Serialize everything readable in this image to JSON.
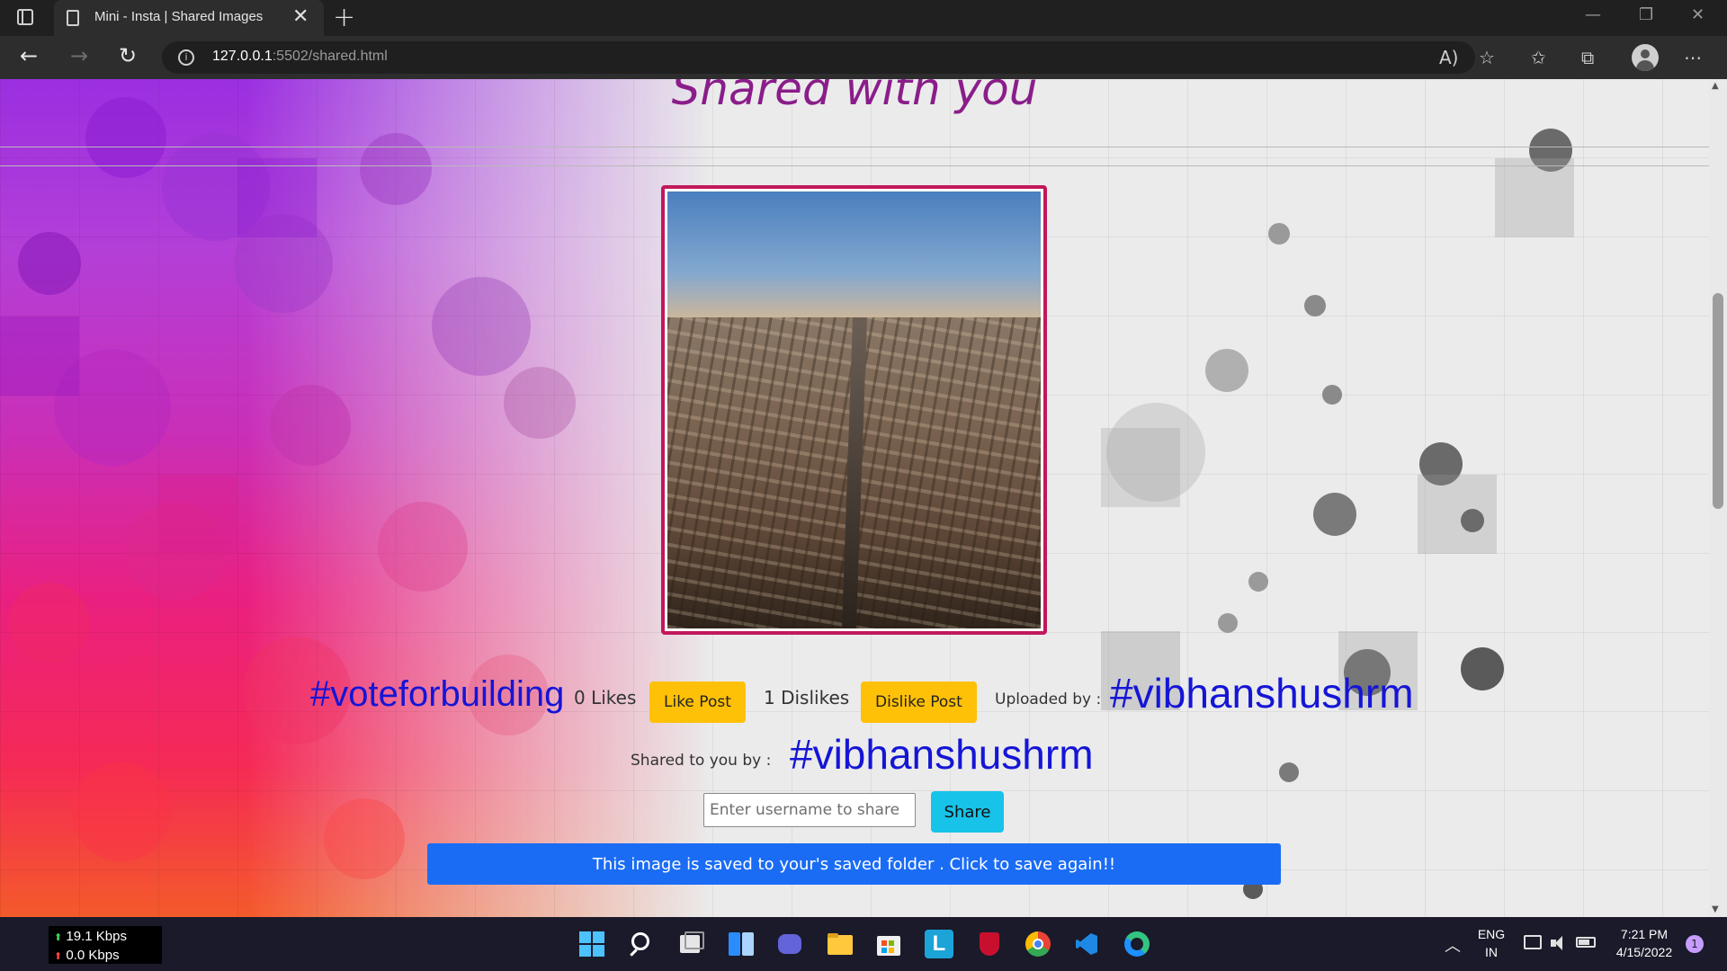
{
  "browser": {
    "tab_title": "Mini - Insta | Shared Images",
    "tab_close": "✕",
    "new_tab": "+",
    "url_host": "127.0.0.1",
    "url_rest": ":5502/shared.html",
    "win_minimize": "—",
    "win_restore": "❐",
    "win_close": "✕",
    "nav_back": "←",
    "nav_forward": "→",
    "nav_reload": "↻",
    "info_icon": "i",
    "tools": [
      "A)",
      "☆",
      "✩",
      "⧉",
      "⋯"
    ]
  },
  "page": {
    "title": "Shared with you",
    "post": {
      "hashtag": "#voteforbuilding",
      "likes_text": "0 Likes",
      "like_button": "Like Post",
      "dislikes_text": "1 Dislikes",
      "dislike_button": "Dislike Post",
      "uploaded_label": "Uploaded by :",
      "uploaded_user": "#vibhanshushrm",
      "shared_label": "Shared to you by :",
      "shared_user": "#vibhanshushrm",
      "share_placeholder": "Enter username to share",
      "share_button": "Share",
      "saved_button": "This image is saved to your's saved folder . Click to save again!!"
    }
  },
  "taskbar": {
    "net_up": "19.1 Kbps",
    "net_down": "0.0 Kbps",
    "lang_top": "ENG",
    "lang_bottom": "IN",
    "time": "7:21 PM",
    "date": "4/15/2022",
    "notification_count": "1",
    "chevron": "︿",
    "net_up_glyph": "⬆",
    "net_down_glyph": "⬆",
    "l_letter": "L"
  },
  "colors": {
    "title": "#8a1d8a",
    "hashtag": "#1515d6",
    "warning_button": "#ffc107",
    "share_button": "#17c3e8",
    "primary_button": "#1a6cf5",
    "photo_border": "#c2185b"
  }
}
